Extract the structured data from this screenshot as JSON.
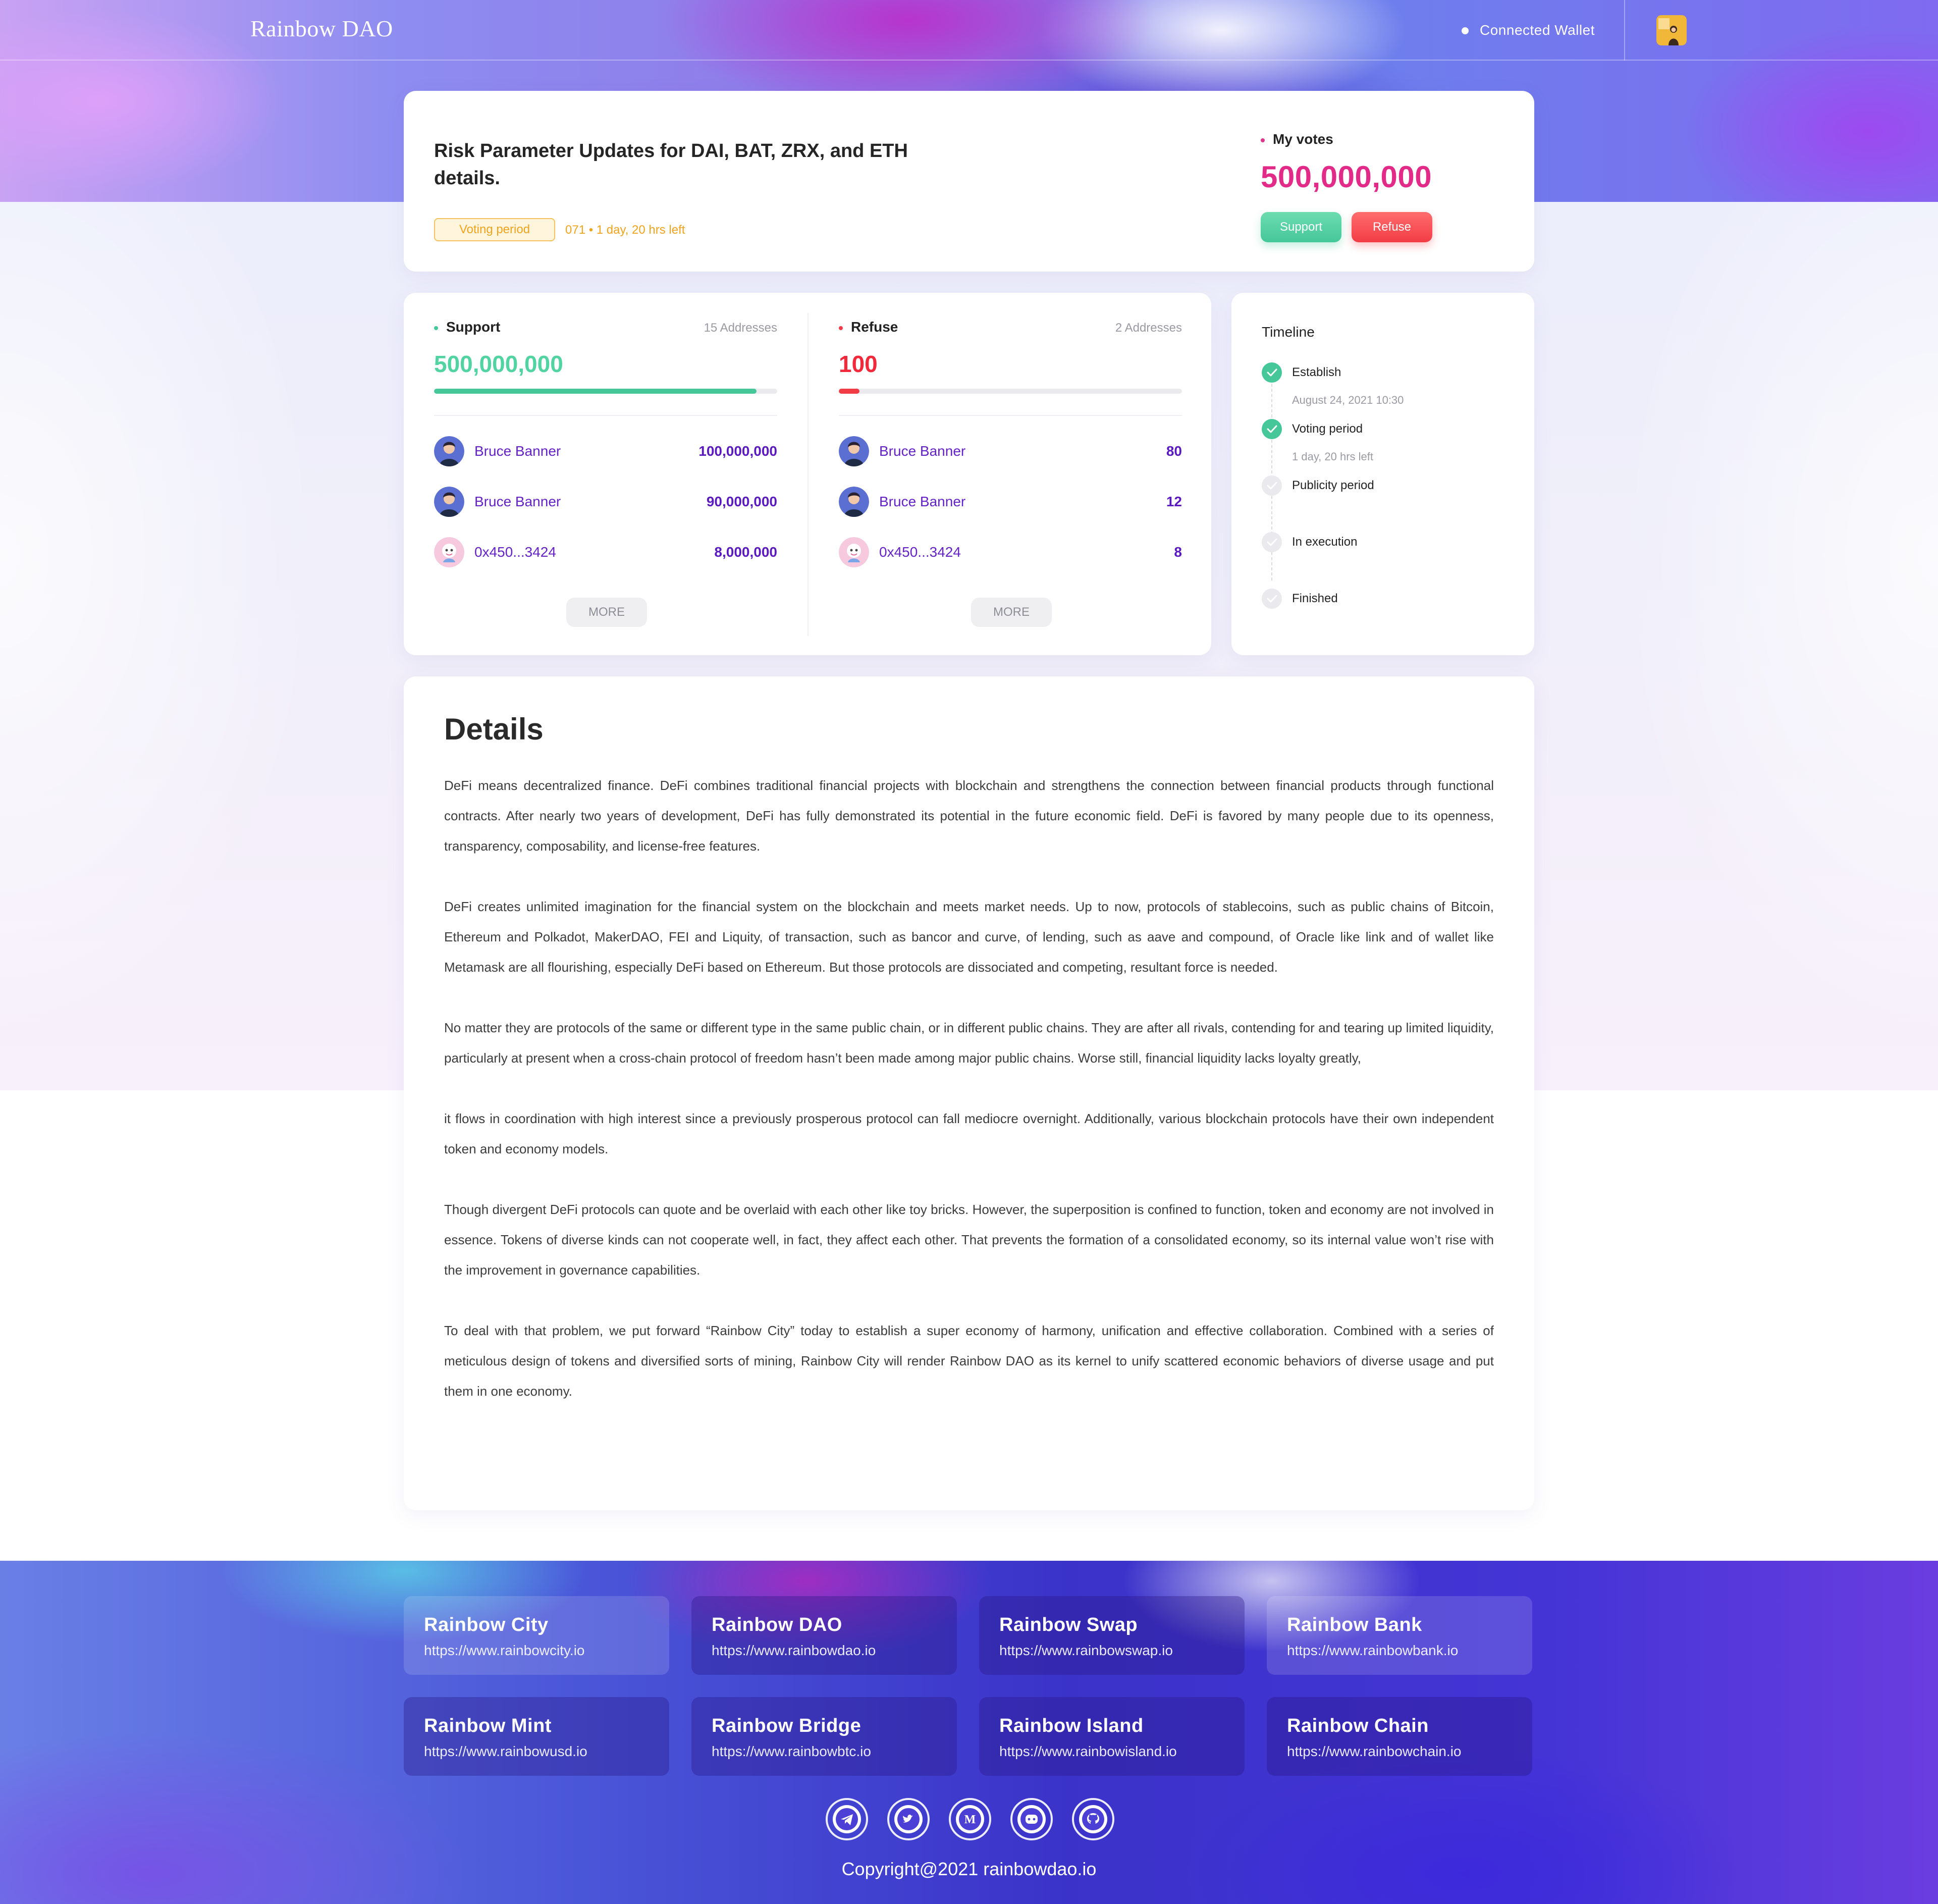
{
  "header": {
    "logo": "Rainbow DAO",
    "wallet_status": "Connected  Wallet"
  },
  "proposal": {
    "title": "Risk Parameter Updates for DAI, BAT, ZRX, and ETH details.",
    "status_badge": "Voting period",
    "period_info": "071 • 1 day, 20 hrs left",
    "my_votes_label": "My votes",
    "my_votes_value": "500,000,000",
    "support_button": "Support",
    "refuse_button": "Refuse"
  },
  "votes": {
    "support": {
      "label": "Support",
      "addresses": "15 Addresses",
      "total": "500,000,000",
      "progress": 0.94,
      "color": "#45c79a",
      "voters": [
        {
          "name": "Bruce Banner",
          "amount": "100,000,000",
          "avatar": "man-avatar"
        },
        {
          "name": "Bruce Banner",
          "amount": "90,000,000",
          "avatar": "man-avatar"
        },
        {
          "name": "0x450...3424",
          "amount": "8,000,000",
          "avatar": "cartoon-avatar"
        }
      ],
      "more_label": "MORE"
    },
    "refuse": {
      "label": "Refuse",
      "addresses": "2 Addresses",
      "total": "100",
      "progress": 0.06,
      "color": "#f23c45",
      "voters": [
        {
          "name": "Bruce Banner",
          "amount": "80",
          "avatar": "man-avatar"
        },
        {
          "name": "Bruce Banner",
          "amount": "12",
          "avatar": "man-avatar"
        },
        {
          "name": "0x450...3424",
          "amount": "8",
          "avatar": "cartoon-avatar"
        }
      ],
      "more_label": "MORE"
    }
  },
  "timeline": {
    "title": "Timeline",
    "steps": [
      {
        "label": "Establish",
        "sub": "August 24, 2021  10:30",
        "done": true
      },
      {
        "label": "Voting period",
        "sub": "1 day, 20 hrs left",
        "done": true
      },
      {
        "label": "Publicity period",
        "sub": "",
        "done": false
      },
      {
        "label": "In execution",
        "sub": "",
        "done": false
      },
      {
        "label": "Finished",
        "sub": "",
        "done": false
      }
    ]
  },
  "details": {
    "title": "Details",
    "paragraphs": [
      "DeFi means decentralized finance. DeFi combines traditional financial projects with blockchain and strengthens the connection between financial products through functional contracts. After nearly two years of development, DeFi has fully demonstrated its potential in the future economic field. DeFi is favored by many people due to its openness, transparency, composability, and license-free features.",
      "DeFi creates unlimited imagination for the financial system on the blockchain and meets market needs. Up to now, protocols of stablecoins, such as public chains of Bitcoin, Ethereum and Polkadot, MakerDAO, FEI and Liquity, of transaction, such as bancor and curve, of lending, such as aave and compound, of Oracle like link and of wallet like Metamask are all flourishing, especially DeFi based on Ethereum. But those protocols are dissociated and competing, resultant force is needed.",
      "No matter they are protocols of the same or different type in the same public chain, or in different public chains. They are after all rivals, contending for and tearing up limited liquidity, particularly at present when a cross-chain protocol of freedom hasn’t been made among major public chains. Worse still, financial liquidity lacks loyalty greatly,",
      "it flows in coordination with high interest since a previously prosperous protocol can fall mediocre overnight. Additionally, various blockchain protocols have their own independent token and economy models.",
      "Though divergent DeFi protocols can quote and be overlaid with each other like toy bricks. However, the superposition is confined to function, token and economy are not involved in essence. Tokens of diverse kinds can not cooperate well, in fact, they affect each other. That prevents the formation of a consolidated economy, so its internal value won’t rise with the improvement in governance capabilities.",
      "To deal with that problem, we put forward “Rainbow City” today to establish a super economy of harmony, unification and effective collaboration. Combined with a series of meticulous design of tokens and diversified sorts of mining, Rainbow City will render Rainbow DAO as its kernel to unify scattered economic behaviors of diverse usage and put them in one economy."
    ]
  },
  "footer": {
    "projects": [
      {
        "name": "Rainbow City",
        "url": "https://www.rainbowcity.io"
      },
      {
        "name": "Rainbow DAO",
        "url": "https://www.rainbowdao.io"
      },
      {
        "name": "Rainbow Swap",
        "url": "https://www.rainbowswap.io"
      },
      {
        "name": "Rainbow Bank",
        "url": "https://www.rainbowbank.io"
      },
      {
        "name": "Rainbow Mint",
        "url": "https://www.rainbowusd.io"
      },
      {
        "name": "Rainbow Bridge",
        "url": "https://www.rainbowbtc.io"
      },
      {
        "name": "Rainbow Island",
        "url": "https://www.rainbowisland.io"
      },
      {
        "name": "Rainbow Chain",
        "url": "https://www.rainbowchain.io"
      }
    ],
    "socials": [
      "telegram-icon",
      "twitter-icon",
      "medium-icon",
      "discord-icon",
      "github-icon"
    ],
    "copyright": "Copyright@2021 rainbowdao.io"
  }
}
